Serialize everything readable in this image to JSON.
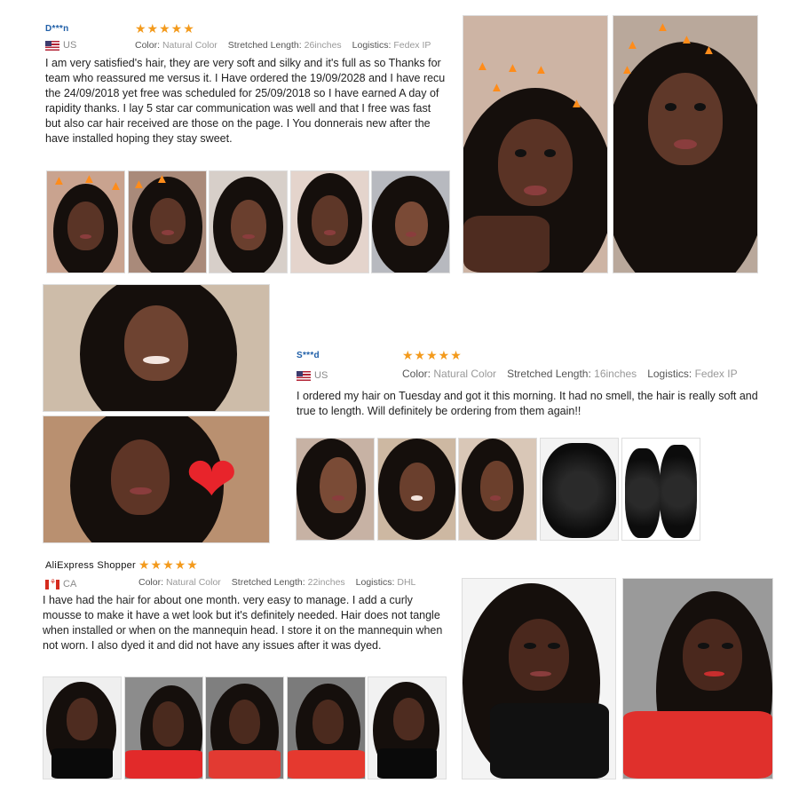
{
  "review1": {
    "name": "D***n",
    "stars": "★★★★★",
    "country": "US",
    "color_label": "Color:",
    "color_value": "Natural Color",
    "length_label": "Stretched Length:",
    "length_value": "26inches",
    "logistics_label": "Logistics:",
    "logistics_value": "Fedex IP",
    "text": "I am very satisfied's hair, they are very soft and silky and it's full as so Thanks for team who reassured me versus it. I Have ordered the 19/09/2028 and I have recu the 24/09/2018 yet free was scheduled for 25/09/2018 so I have earned A day of rapidity thanks. I lay 5 star car communication was well and that I free was fast but also car hair received are those on the page. I You donnerais new after the have installed hoping they stay sweet."
  },
  "review2": {
    "name": "S***d",
    "stars": "★★★★★",
    "country": "US",
    "color_label": "Color:",
    "color_value": "Natural Color",
    "length_label": "Stretched Length:",
    "length_value": "16inches",
    "logistics_label": "Logistics:",
    "logistics_value": "Fedex IP",
    "text": "I ordered my hair on Tuesday and got it this morning. It had no smell, the hair is really soft and true to length. Will definitely be ordering from them again!!"
  },
  "review3": {
    "name": "AliExpress Shopper",
    "stars": "★★★★★",
    "country": "CA",
    "color_label": "Color:",
    "color_value": "Natural Color",
    "length_label": "Stretched Length:",
    "length_value": "22inches",
    "logistics_label": "Logistics:",
    "logistics_value": "DHL",
    "text": "I have had the hair for about one month. very easy to manage. I add a curly mousse to make it have a wet look but it's definitely needed. Hair does not tangle when installed or when on the mannequin head. I store it on the mannequin when not worn. I also dyed it and did not have any issues after it was dyed."
  },
  "colors": {
    "reviewer_name": "#1f5fa8",
    "stars": "#f39a1c",
    "heart": "#e8242b"
  },
  "icons": [
    "star-icon",
    "us-flag-icon",
    "ca-flag-icon",
    "heart-sticker-icon",
    "fire-sticker-icon"
  ]
}
